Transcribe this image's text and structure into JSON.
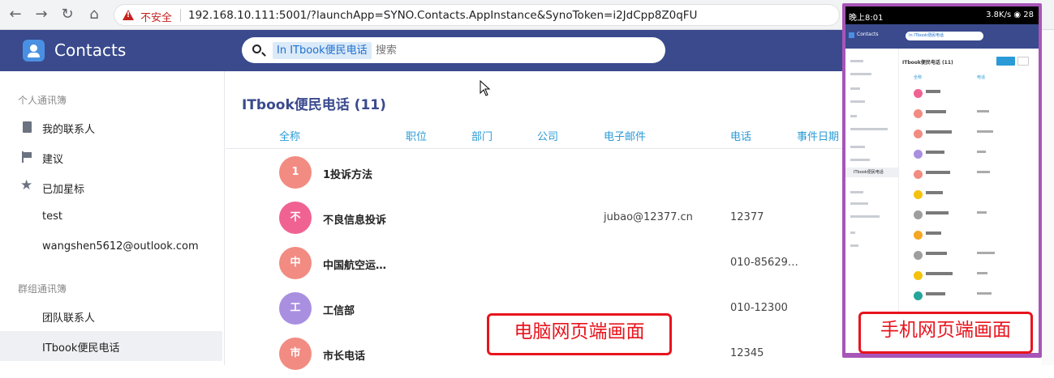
{
  "browser": {
    "security_label": "不安全",
    "url": "192.168.10.111:5001/?launchApp=SYNO.Contacts.AppInstance&SynoToken=i2JdCpp8Z0qFU"
  },
  "header": {
    "app_title": "Contacts",
    "search_scope": "In ITbook便民电话",
    "search_placeholder": "搜索"
  },
  "sidebar": {
    "personal_title": "个人通讯簿",
    "personal_items": [
      {
        "label": "我的联系人",
        "icon": "address-book-icon"
      },
      {
        "label": "建议",
        "icon": "flag-icon"
      },
      {
        "label": "已加星标",
        "icon": "star-icon"
      },
      {
        "label": "test"
      },
      {
        "label": "wangshen5612@outlook.com"
      }
    ],
    "group_title": "群组通讯簿",
    "group_items": [
      {
        "label": "团队联系人"
      },
      {
        "label": "ITbook便民电话",
        "active": true
      }
    ]
  },
  "main": {
    "list_title": "ITbook便民电话 (11)",
    "columns": [
      "全称",
      "职位",
      "部门",
      "公司",
      "电子邮件",
      "电话",
      "事件日期"
    ],
    "rows": [
      {
        "avatar_text": "1",
        "avatar_color": "#f28b82",
        "name": "1投诉方法",
        "email": "",
        "phone": ""
      },
      {
        "avatar_text": "不",
        "avatar_color": "#f06292",
        "name": "不良信息投诉",
        "email": "jubao@12377.cn",
        "phone": "12377"
      },
      {
        "avatar_text": "中",
        "avatar_color": "#f28b82",
        "name": "中国航空运…",
        "email": "",
        "phone": "010-85629…"
      },
      {
        "avatar_text": "工",
        "avatar_color": "#a98fe0",
        "name": "工信部",
        "email": "",
        "phone": "010-12300"
      },
      {
        "avatar_text": "市",
        "avatar_color": "#f28b82",
        "name": "市长电话",
        "email": "",
        "phone": "12345"
      }
    ]
  },
  "phone": {
    "status_time": "晚上8:01",
    "status_speed": "3.8K/s",
    "status_battery": "28",
    "mobile_avatar_colors": [
      "#f06292",
      "#f28b82",
      "#f28b82",
      "#a98fe0",
      "#f28b82",
      "#f4c20d",
      "#9e9e9e",
      "#f5a623",
      "#9e9e9e",
      "#f4c20d",
      "#26a69a"
    ]
  },
  "annotations": {
    "pc_label": "电脑网页端画面",
    "mobile_label": "手机网页端画面"
  }
}
